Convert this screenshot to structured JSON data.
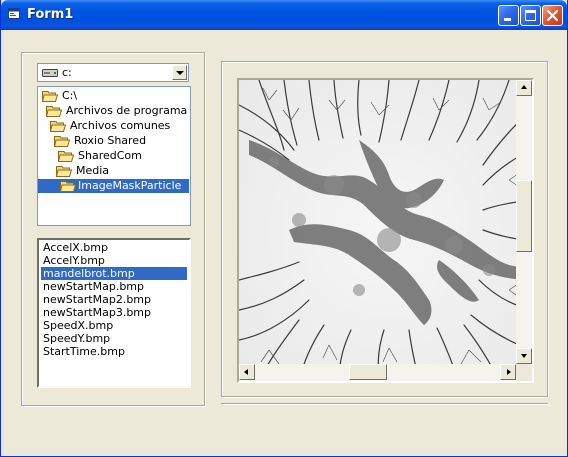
{
  "window": {
    "title": "Form1",
    "icon": "form-icon",
    "controls": [
      "minimize-icon",
      "maximize-icon",
      "close-icon"
    ]
  },
  "drive_combo": {
    "icon": "drive-icon",
    "selected": "c:"
  },
  "dir_list": {
    "items": [
      {
        "label": "C:\\",
        "icon": "open-folder-icon"
      },
      {
        "label": "Archivos de programa",
        "icon": "open-folder-icon"
      },
      {
        "label": "Archivos comunes",
        "icon": "open-folder-icon"
      },
      {
        "label": "Roxio Shared",
        "icon": "open-folder-icon"
      },
      {
        "label": "SharedCom",
        "icon": "open-folder-icon"
      },
      {
        "label": "Media",
        "icon": "open-folder-icon"
      },
      {
        "label": "ImageMaskParticle",
        "icon": "open-folder-icon"
      }
    ],
    "selected_label": "ImageMaskParticle"
  },
  "file_list": {
    "items": [
      "AccelX.bmp",
      "AccelY.bmp",
      "mandelbrot.bmp",
      "newStartMap.bmp",
      "newStartMap2.bmp",
      "newStartMap3.bmp",
      "SpeedX.bmp",
      "SpeedY.bmp",
      "StartTime.bmp"
    ],
    "selected": "mandelbrot.bmp"
  },
  "picture": {
    "content": "mandelbrot fractal image (grayscale)",
    "vertical_scroll": {
      "up": "arrow-up-icon",
      "down": "arrow-down-icon"
    },
    "horizontal_scroll": {
      "left": "arrow-left-icon",
      "right": "arrow-right-icon"
    }
  },
  "colors": {
    "selection": "#316ac5",
    "window_bg": "#ece9d8",
    "titlebar": "#0053e1"
  }
}
